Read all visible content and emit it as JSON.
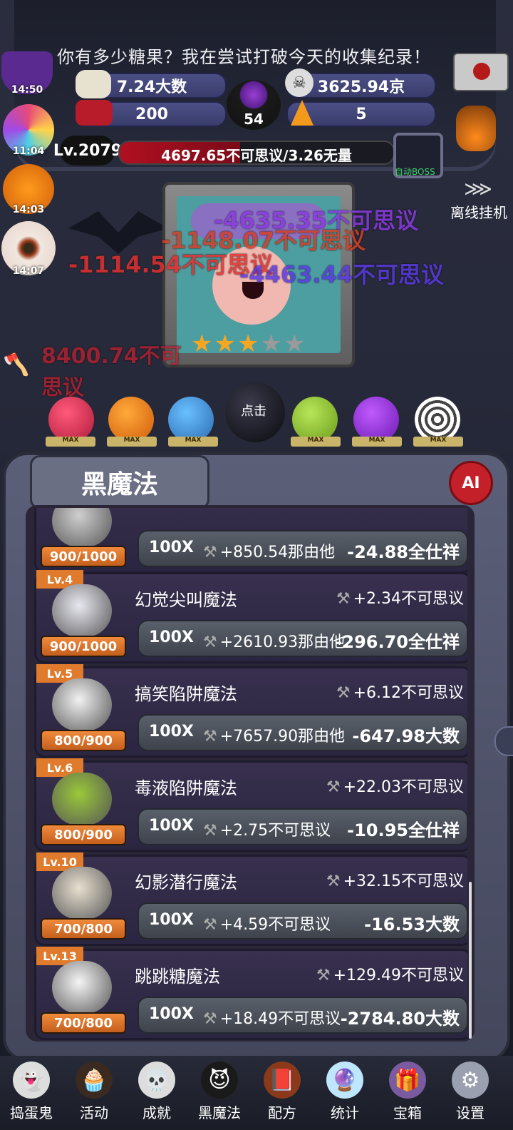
{
  "header": {
    "headline": "你有多少糖果？我在尝试打破今天的收集纪录！",
    "stat_candy": "7.24大数",
    "stat_skull": "3625.94京",
    "stat_candybow": "200",
    "stat_cauldron": "54",
    "stat_corn": "5",
    "level": "Lv.2079",
    "xp_text": "4697.65不可思议/3.26无量",
    "xp_fraction": 0.44,
    "auto_boss": "自动BOSS",
    "offline": "离线挂机"
  },
  "side_timers": {
    "hat": "14:50",
    "lollipop": "11:04",
    "pumpkin": "14:03",
    "eyeball": "14:07"
  },
  "boss": {
    "stars_filled": 3,
    "stars_total": 5,
    "damage_floaters": [
      "-4635.35不可思议",
      "-1148.07不可思议",
      "-1114.54不可思议",
      "-4463.44不可思议",
      "8400.74不可思议"
    ],
    "tap_label": "点击"
  },
  "monsters": {
    "max_label": "MAX"
  },
  "panel": {
    "title": "黑魔法",
    "ai_label": "AI"
  },
  "skills": [
    {
      "lv": "",
      "name": "",
      "rate": "",
      "progress": "900/1000",
      "mult": "100X",
      "gain": "+850.54那由他",
      "cost": "-24.88全仕祥"
    },
    {
      "lv": "Lv.4",
      "name": "幻觉尖叫魔法",
      "rate": "+2.34不可思议",
      "progress": "900/1000",
      "mult": "100X",
      "gain": "+2610.93那由他",
      "cost": "-296.70全仕祥"
    },
    {
      "lv": "Lv.5",
      "name": "搞笑陷阱魔法",
      "rate": "+6.12不可思议",
      "progress": "800/900",
      "mult": "100X",
      "gain": "+7657.90那由他",
      "cost": "-647.98大数"
    },
    {
      "lv": "Lv.6",
      "name": "毒液陷阱魔法",
      "rate": "+22.03不可思议",
      "progress": "800/900",
      "mult": "100X",
      "gain": "+2.75不可思议",
      "cost": "-10.95全仕祥"
    },
    {
      "lv": "Lv.10",
      "name": "幻影潜行魔法",
      "rate": "+32.15不可思议",
      "progress": "700/800",
      "mult": "100X",
      "gain": "+4.59不可思议",
      "cost": "-16.53大数"
    },
    {
      "lv": "Lv.13",
      "name": "跳跳糖魔法",
      "rate": "+129.49不可思议",
      "progress": "700/800",
      "mult": "100X",
      "gain": "+18.49不可思议",
      "cost": "-2784.80大数"
    }
  ],
  "nav": [
    {
      "label": "捣蛋鬼",
      "icon": "ghost-icon"
    },
    {
      "label": "活动",
      "icon": "eyeball-cupcake-icon"
    },
    {
      "label": "成就",
      "icon": "skull-trophy-icon"
    },
    {
      "label": "黑魔法",
      "icon": "demon-icon"
    },
    {
      "label": "配方",
      "icon": "recipe-book-icon"
    },
    {
      "label": "统计",
      "icon": "crystal-ball-icon"
    },
    {
      "label": "宝箱",
      "icon": "chest-icon"
    },
    {
      "label": "设置",
      "icon": "gear-icon"
    }
  ]
}
